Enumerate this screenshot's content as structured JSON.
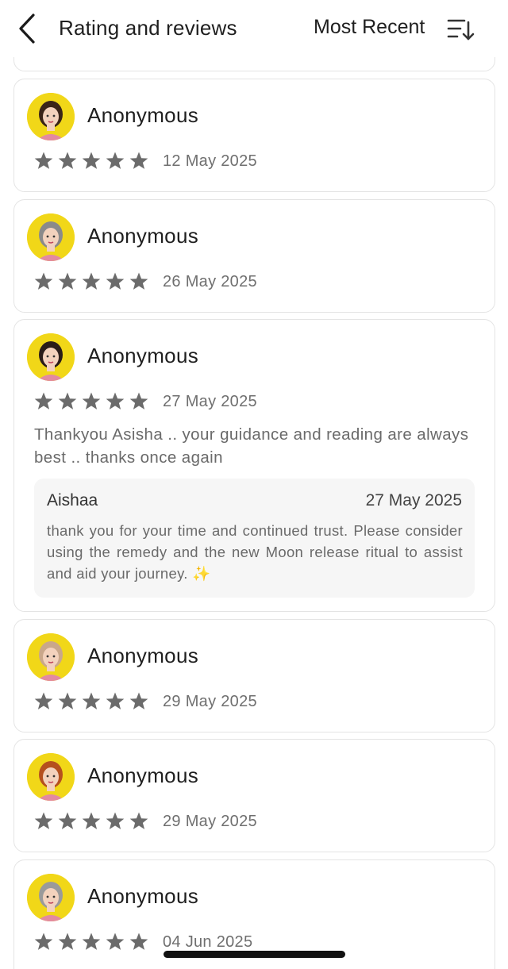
{
  "header": {
    "title": "Rating and reviews",
    "sort_label": "Most Recent",
    "back_icon": "chevron-left-icon",
    "sort_icon": "sort-descending-icon"
  },
  "colors": {
    "star": "#6b6b6b",
    "avatar_bg": "#f1d718",
    "border": "#e4e4e4",
    "reply_bg": "#f6f6f6"
  },
  "reviews": [
    {
      "name": "Anonymous",
      "rating": 5,
      "date": "12 May 2025",
      "avatar_icon": "zodiac-avatar-icon"
    },
    {
      "name": "Anonymous",
      "rating": 5,
      "date": "26 May 2025",
      "avatar_icon": "zodiac-avatar-icon"
    },
    {
      "name": "Anonymous",
      "rating": 5,
      "date": "27 May 2025",
      "avatar_icon": "zodiac-avatar-icon",
      "text": "Thankyou Asisha .. your guidance and reading are always best .. thanks once again",
      "reply": {
        "name": "Aishaa",
        "date": "27 May 2025",
        "text": "thank you for your time and continued trust. Please consider using the remedy and the new Moon release ritual to assist and aid your journey. ✨"
      }
    },
    {
      "name": "Anonymous",
      "rating": 5,
      "date": "29 May 2025",
      "avatar_icon": "zodiac-avatar-icon"
    },
    {
      "name": "Anonymous",
      "rating": 5,
      "date": "29 May 2025",
      "avatar_icon": "zodiac-avatar-icon"
    },
    {
      "name": "Anonymous",
      "rating": 5,
      "date": "04 Jun 2025",
      "avatar_icon": "zodiac-avatar-icon"
    }
  ]
}
